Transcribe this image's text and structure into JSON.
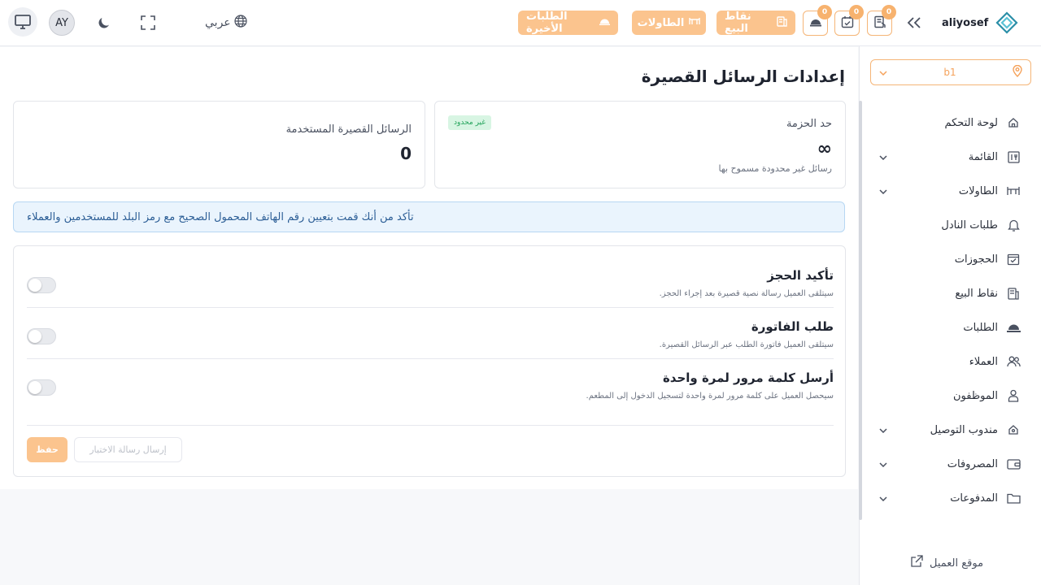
{
  "header": {
    "brand_name": "aliyosef",
    "language_label": "عربي",
    "avatar_initials": "AY",
    "pills": {
      "recent_orders": "الطلبات الأخيرة",
      "tables": "الطاولات",
      "pos": "نقاط البيع"
    },
    "badges": {
      "b1": "0",
      "b2": "0",
      "b3": "0"
    }
  },
  "sidebar": {
    "branch": "b1",
    "items": [
      {
        "label": "لوحة التحكم",
        "icon": "home-icon",
        "expandable": false
      },
      {
        "label": "القائمة",
        "icon": "menu-icon",
        "expandable": true
      },
      {
        "label": "الطاولات",
        "icon": "table-icon",
        "expandable": true
      },
      {
        "label": "طلبات النادل",
        "icon": "bell-icon",
        "expandable": false
      },
      {
        "label": "الحجوزات",
        "icon": "calendar-check-icon",
        "expandable": false
      },
      {
        "label": "نقاط البيع",
        "icon": "pos-icon",
        "expandable": false
      },
      {
        "label": "الطلبات",
        "icon": "cloche-icon",
        "expandable": false
      },
      {
        "label": "العملاء",
        "icon": "users-icon",
        "expandable": false
      },
      {
        "label": "الموظفون",
        "icon": "staff-icon",
        "expandable": false
      },
      {
        "label": "مندوب التوصيل",
        "icon": "delivery-icon",
        "expandable": true
      },
      {
        "label": "المصروفات",
        "icon": "wallet-icon",
        "expandable": true
      },
      {
        "label": "المدفوعات",
        "icon": "folder-icon",
        "expandable": true
      }
    ],
    "client_site": "موقع العميل"
  },
  "main": {
    "title": "إعدادات الرسائل القصيرة",
    "limit_card": {
      "label": "حد الحزمة",
      "tag": "غير محدود",
      "value": "∞",
      "sub": "رسائل غير محدودة مسموح بها"
    },
    "used_card": {
      "label": "الرسائل القصيرة المستخدمة",
      "value": "0"
    },
    "notice": "تأكد من أنك قمت بتعيين رقم الهاتف المحمول الصحيح مع رمز البلد للمستخدمين والعملاء",
    "settings": [
      {
        "title": "تأكيد الحجز",
        "desc": "سيتلقى العميل رسالة نصية قصيرة بعد إجراء الحجز.",
        "enabled": false
      },
      {
        "title": "طلب الفاتورة",
        "desc": "سيتلقى العميل فاتورة الطلب عبر الرسائل القصيرة.",
        "enabled": false
      },
      {
        "title": "أرسل كلمة مرور لمرة واحدة",
        "desc": "سيحصل العميل على كلمة مرور لمرة واحدة لتسجيل الدخول إلى المطعم.",
        "enabled": false
      }
    ],
    "buttons": {
      "save": "حفظ",
      "test": "إرسال رسالة الاختبار"
    }
  }
}
